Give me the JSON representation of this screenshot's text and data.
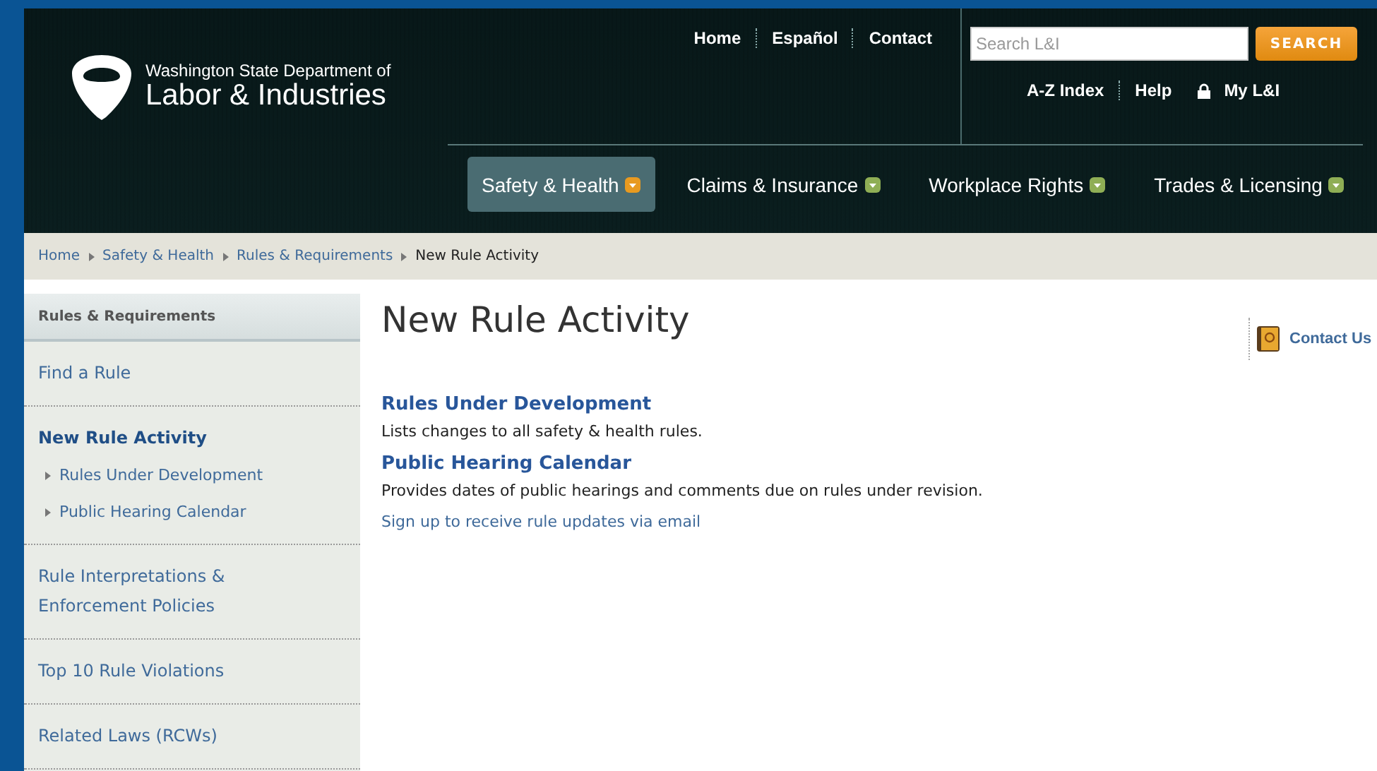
{
  "header": {
    "logo": {
      "line1": "Washington State Department of",
      "line2": "Labor & Industries"
    },
    "top_links": [
      "Home",
      "Español",
      "Contact"
    ],
    "search": {
      "placeholder": "Search L&I",
      "button": "SEARCH"
    },
    "utility_links": [
      {
        "label": "A-Z Index",
        "kind": "link"
      },
      {
        "label": "Help",
        "kind": "link"
      },
      {
        "label": "My L&I",
        "kind": "locked"
      }
    ],
    "nav_tabs": [
      {
        "label": "Safety & Health",
        "selected": true
      },
      {
        "label": "Claims & Insurance",
        "selected": false
      },
      {
        "label": "Workplace Rights",
        "selected": false
      },
      {
        "label": "Trades & Licensing",
        "selected": false
      }
    ]
  },
  "breadcrumb": [
    "Home",
    "Safety & Health",
    "Rules & Requirements",
    "New Rule Activity"
  ],
  "sidebar": {
    "title": "Rules & Requirements",
    "items": [
      {
        "label": "Find a Rule",
        "selected": false
      },
      {
        "label": "New Rule Activity",
        "selected": true,
        "children": [
          {
            "label": "Rules Under Development"
          },
          {
            "label": "Public Hearing Calendar"
          }
        ]
      },
      {
        "label": "Rule Interpretations & Enforcement Policies",
        "selected": false
      },
      {
        "label": "Top 10 Rule Violations",
        "selected": false
      },
      {
        "label": "Related Laws (RCWs)",
        "selected": false
      }
    ]
  },
  "main": {
    "title": "New Rule Activity",
    "sections": [
      {
        "heading": "Rules Under Development",
        "description": "Lists changes to all safety & health rules."
      },
      {
        "heading": "Public Hearing Calendar",
        "description": "Provides dates of public hearings and comments due on rules under revision."
      }
    ],
    "signup_link": "Sign up to receive rule updates via email"
  },
  "contact": {
    "label": "Contact Us"
  }
}
